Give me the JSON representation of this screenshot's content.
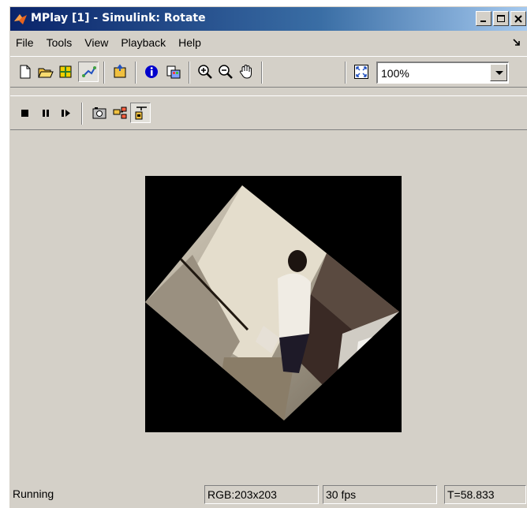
{
  "window": {
    "title": "MPlay [1] - Simulink: Rotate",
    "app_icon": "matlab-logo-icon",
    "caption_buttons": [
      "minimize-icon",
      "maximize-icon",
      "close-icon"
    ]
  },
  "menu": {
    "items": [
      {
        "label": "File"
      },
      {
        "label": "Tools"
      },
      {
        "label": "View"
      },
      {
        "label": "Playback"
      },
      {
        "label": "Help"
      }
    ]
  },
  "toolbar": {
    "icons": [
      "new-icon",
      "open-icon",
      "export-icon",
      "connect-icon",
      "open-simulink-icon",
      "info-icon",
      "colormap-icon",
      "zoom-in-icon",
      "zoom-out-icon",
      "pan-hand-icon",
      "fit-to-window-icon"
    ],
    "zoom_value": "100%",
    "playback_icons": [
      "stop-icon",
      "pause-icon",
      "step-forward-icon",
      "snapshot-icon",
      "highlight-block-icon",
      "floating-scope-icon"
    ]
  },
  "status": {
    "state": "Running",
    "format": "RGB:203x203",
    "rate": "30 fps",
    "time": "T=58.833"
  },
  "colors": {
    "title_start": "#0a246a",
    "title_end": "#a6caf0",
    "chrome": "#d4d0c8",
    "info_blue": "#0000cc"
  }
}
